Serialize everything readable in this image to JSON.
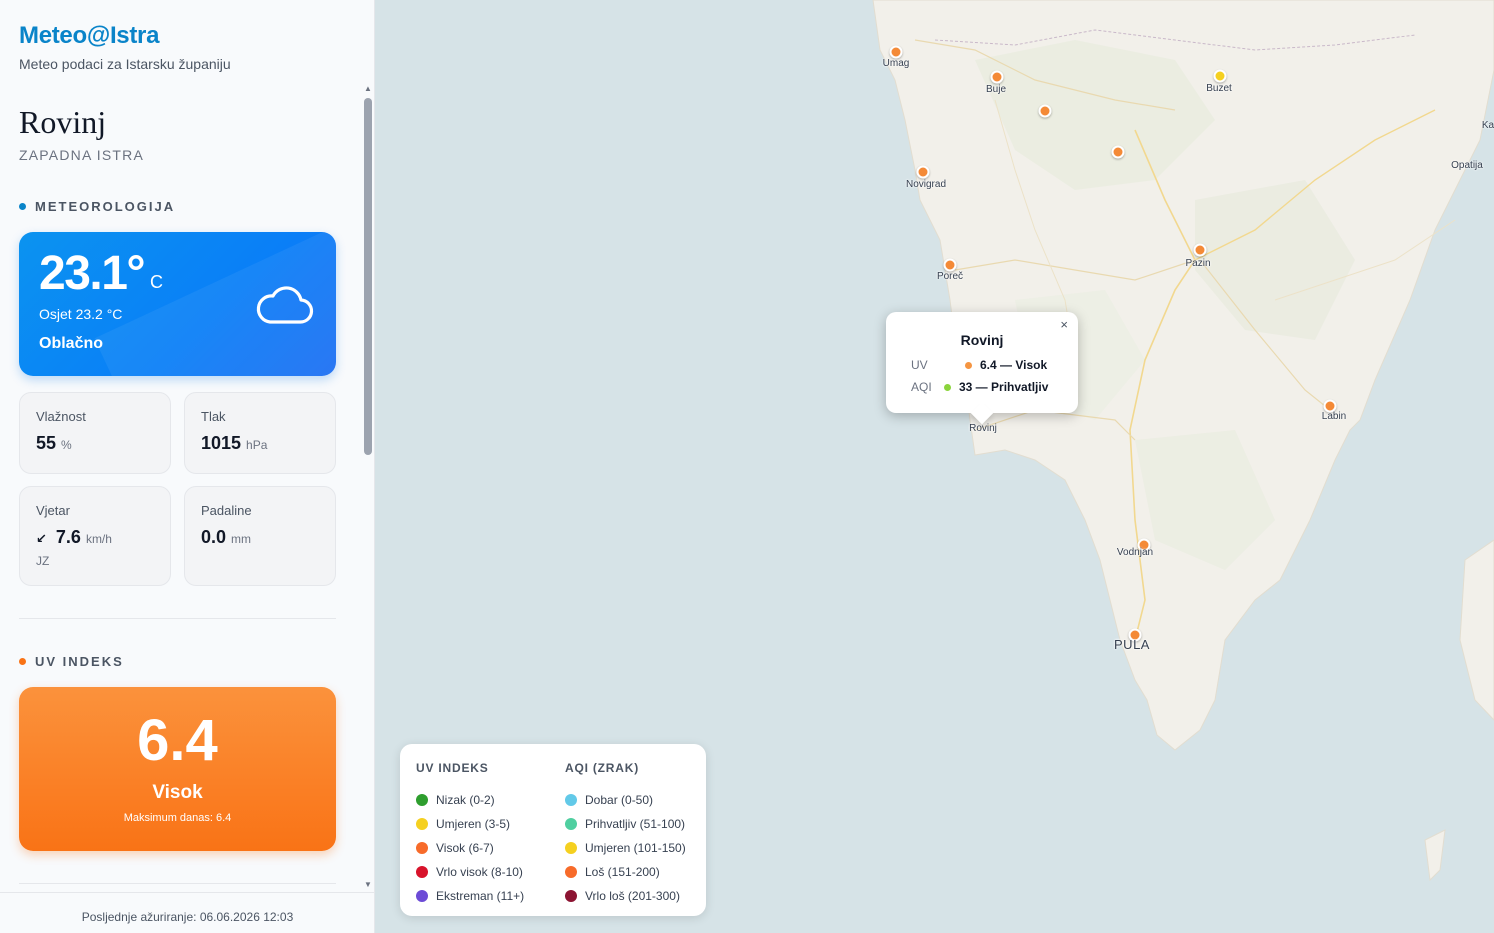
{
  "brand": {
    "title": "Meteo@Istra",
    "subtitle": "Meteo podaci za Istarsku županiju"
  },
  "location": {
    "name": "Rovinj",
    "region": "ZAPADNA ISTRA"
  },
  "meteo": {
    "section_title": "METEOROLOGIJA",
    "temperature": "23.1°",
    "temperature_unit": "C",
    "feels_like": "Osjet 23.2 °C",
    "condition": "Oblačno",
    "icon": "cloud-icon",
    "humidity": {
      "label": "Vlažnost",
      "value": "55",
      "unit": "%"
    },
    "pressure": {
      "label": "Tlak",
      "value": "1015",
      "unit": "hPa"
    },
    "wind": {
      "label": "Vjetar",
      "value": "7.6",
      "unit": "km/h",
      "direction": "JZ",
      "arrow": "↙"
    },
    "precipitation": {
      "label": "Padaline",
      "value": "0.0",
      "unit": "mm"
    }
  },
  "uv": {
    "section_title": "UV INDEKS",
    "value": "6.4",
    "level": "Visok",
    "max_today": "Maksimum danas: 6.4"
  },
  "footer": {
    "last_update": "Posljednje ažuriranje: 06.06.2026 12:03"
  },
  "map": {
    "towns": [
      {
        "name": "Umag"
      },
      {
        "name": "Buje"
      },
      {
        "name": "Buzet"
      },
      {
        "name": "Novigrad"
      },
      {
        "name": "Poreč"
      },
      {
        "name": "Pazin"
      },
      {
        "name": "Rovinj"
      },
      {
        "name": "Labin"
      },
      {
        "name": "Vodnjan"
      },
      {
        "name": "PULA"
      },
      {
        "name": "Opatija"
      },
      {
        "name": "Ka"
      }
    ],
    "popup": {
      "title": "Rovinj",
      "close": "×",
      "uv_key": "UV",
      "uv_value": "6.4 — Visok",
      "uv_color": "#f59542",
      "aqi_key": "AQI",
      "aqi_value": "33 — Prihvatljiv",
      "aqi_color": "#8bd43c"
    },
    "legend": {
      "uv_title": "UV INDEKS",
      "uv_items": [
        {
          "label": "Nizak (0-2)",
          "color": "#2e9e2e"
        },
        {
          "label": "Umjeren (3-5)",
          "color": "#f5d020"
        },
        {
          "label": "Visok (6-7)",
          "color": "#f76b2a"
        },
        {
          "label": "Vrlo visok (8-10)",
          "color": "#d8132b"
        },
        {
          "label": "Ekstreman (11+)",
          "color": "#6c4bd6"
        }
      ],
      "aqi_title": "AQI (ZRAK)",
      "aqi_items": [
        {
          "label": "Dobar (0-50)",
          "color": "#62c9e8"
        },
        {
          "label": "Prihvatljiv (51-100)",
          "color": "#4fcfa0"
        },
        {
          "label": "Umjeren (101-150)",
          "color": "#f5d020"
        },
        {
          "label": "Loš (151-200)",
          "color": "#f76b2a"
        },
        {
          "label": "Vrlo loš (201-300)",
          "color": "#8c1432"
        }
      ]
    }
  }
}
